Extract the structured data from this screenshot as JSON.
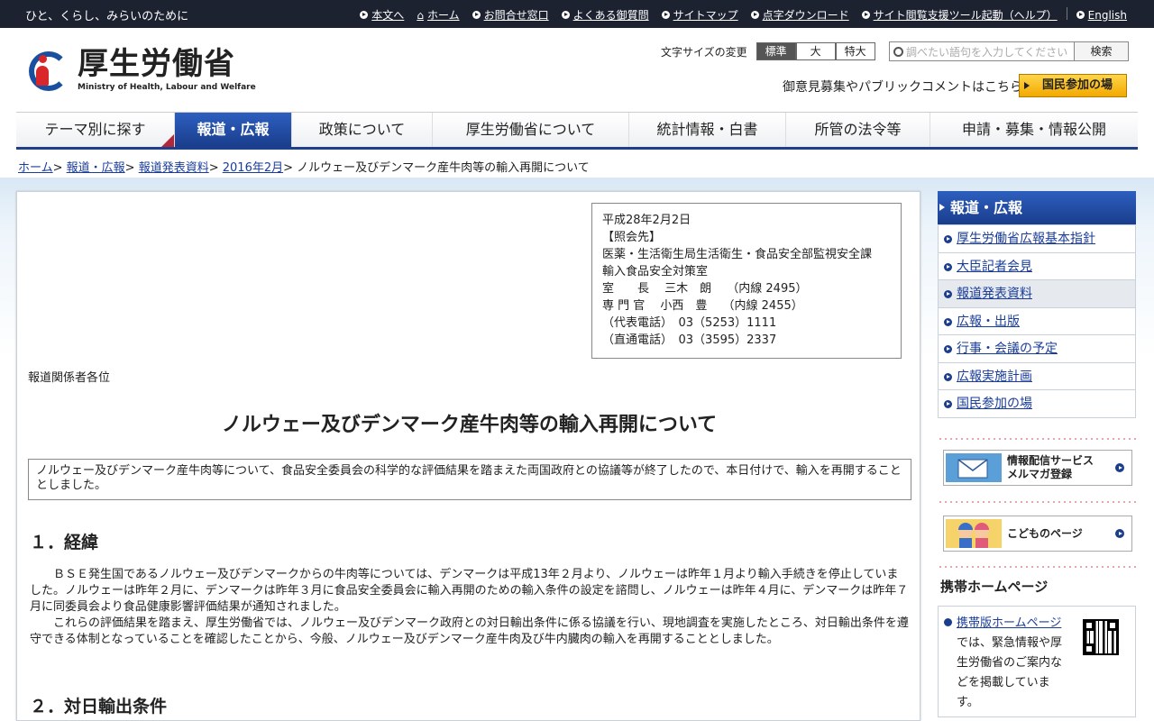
{
  "topbar": {
    "tagline": "ひと、くらし、みらいのために",
    "links": [
      "本文へ",
      "ホーム",
      "お問合せ窓口",
      "よくある御質問",
      "サイトマップ",
      "点字ダウンロード",
      "サイト閲覧支援ツール起動（ヘルプ）",
      "English"
    ]
  },
  "header": {
    "logo_ja": "厚生労働省",
    "logo_en": "Ministry of Health, Labour and Welfare",
    "fontsize_label": "文字サイズの変更",
    "fontsize_options": [
      "標準",
      "大",
      "特大"
    ],
    "search_placeholder": "調べたい語句を入力してください",
    "search_button": "検索",
    "pubcomment": "御意見募集やパブリックコメントはこちら",
    "kokumin": "国民参加の場"
  },
  "gnav": [
    "テーマ別に探す",
    "報道・広報",
    "政策について",
    "厚生労働省について",
    "統計情報・白書",
    "所管の法令等",
    "申請・募集・情報公開"
  ],
  "breadcrumb": {
    "items": [
      "ホーム",
      "報道・広報",
      "報道発表資料",
      "2016年2月"
    ],
    "current": "ノルウェー及びデンマーク産牛肉等の輸入再開について"
  },
  "contact": {
    "lines": [
      "平成28年2月2日",
      "【照会先】",
      "医薬・生活衛生局生活衛生・食品安全部監視安全課",
      "輸入食品安全対策室",
      "室　　長　 三木　朗　 （内線 2495）",
      "専 門 官　 小西　豊　 （内線 2455）",
      "（代表電話）　03（5253）1111",
      "（直通電話）　03（3595）2337"
    ]
  },
  "article": {
    "addressee": "報道関係者各位",
    "title": "ノルウェー及びデンマーク産牛肉等の輸入再開について",
    "summary": "ノルウェー及びデンマーク産牛肉等について、食品安全委員会の科学的な評価結果を踏まえた両国政府との協議等が終了したので、本日付けで、輸入を再開することとしました。",
    "h1": "１．経緯",
    "p1": "ＢＳＥ発生国であるノルウェー及びデンマークからの牛肉等については、デンマークは平成13年２月より、ノルウェーは昨年１月より輸入手続きを停止していました。ノルウェーは昨年２月に、デンマークは昨年３月に食品安全委員会に輸入再開のための輸入条件の設定を諮問し、ノルウェーは昨年４月に、デンマークは昨年７月に同委員会より食品健康影響評価結果が通知されました。",
    "p2": "これらの評価結果を踏まえ、厚生労働省では、ノルウェー及びデンマーク政府との対日輸出条件に係る協議を行い、現地調査を実施したところ、対日輸出条件を遵守できる体制となっていることを確認したことから、今般、ノルウェー及びデンマーク産牛肉及び牛内臓肉の輸入を再開することとしました。",
    "h2": "２．対日輸出条件"
  },
  "sidebar": {
    "heading": "報道・広報",
    "items": [
      "厚生労働省広報基本指針",
      "大臣記者会見",
      "報道発表資料",
      "広報・出版",
      "行事・会議の予定",
      "広報実施計画",
      "国民参加の場"
    ],
    "banner_mail": [
      "情報配信サービス",
      "メルマガ登録"
    ],
    "banner_kids": "こどものページ",
    "mobile_heading": "携帯ホームページ",
    "mobile_link": "携帯版ホームページ",
    "mobile_text": "では、緊急情報や厚生労働省のご案内などを掲載しています。"
  }
}
